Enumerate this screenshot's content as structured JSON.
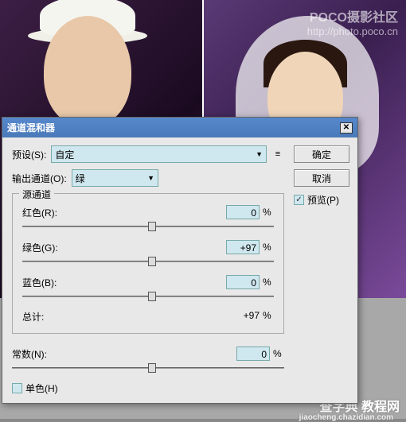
{
  "watermark": {
    "line1": "POCO摄影社区",
    "line2": "http://photo.poco.cn"
  },
  "bottom_watermark": {
    "line1": "查字典 教程网",
    "line2": "jiaocheng.chazidian.com"
  },
  "dialog": {
    "title": "通道混和器",
    "preset_label": "预设(S):",
    "preset_value": "自定",
    "output_label": "输出通道(O):",
    "output_value": "绿",
    "ok": "确定",
    "cancel": "取消",
    "preview_label": "预览(P)",
    "group_title": "源通道",
    "sliders": {
      "red": {
        "label": "红色(R):",
        "value": "0",
        "pos": 50
      },
      "green": {
        "label": "绿色(G):",
        "value": "+97",
        "pos": 50
      },
      "blue": {
        "label": "蓝色(B):",
        "value": "0",
        "pos": 50
      }
    },
    "total_label": "总计:",
    "total_value": "+97",
    "constant": {
      "label": "常数(N):",
      "value": "0",
      "pos": 50
    },
    "mono_label": "单色(H)",
    "percent": "%"
  }
}
